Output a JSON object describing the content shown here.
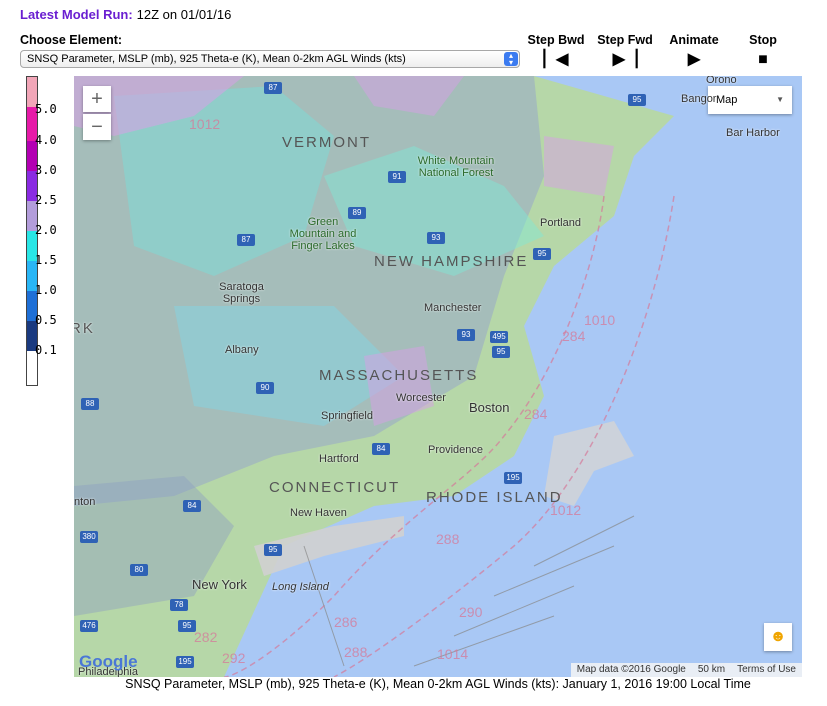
{
  "header": {
    "run_label": "Latest Model Run:",
    "run_value": "12Z on 01/01/16",
    "choose_label": "Choose Element:",
    "selected_element": "SNSQ Parameter, MSLP (mb), 925 Theta-e (K), Mean 0-2km AGL Winds (kts)"
  },
  "controls": [
    {
      "label": "Step Bwd",
      "icon": "step-backward-icon"
    },
    {
      "label": "Step Fwd",
      "icon": "step-forward-icon"
    },
    {
      "label": "Animate",
      "icon": "play-icon"
    },
    {
      "label": "Stop",
      "icon": "stop-icon"
    }
  ],
  "colorscale": {
    "labels": [
      "5.0",
      "4.0",
      "3.0",
      "2.5",
      "2.0",
      "1.5",
      "1.0",
      "0.5",
      "0.1"
    ],
    "colors": [
      "#f2a6b8",
      "#e61aa8",
      "#b300b3",
      "#8a2be2",
      "#b39ddb",
      "#29e6e6",
      "#29b6f6",
      "#1e6fd6",
      "#1a3a80",
      "#ffffff"
    ]
  },
  "map": {
    "zoom_in": "+",
    "zoom_out": "−",
    "map_type": "Map",
    "states": [
      "VERMONT",
      "NEW HAMPSHIRE",
      "MASSACHUSETTS",
      "CONNECTICUT",
      "RHODE ISLAND"
    ],
    "places": [
      "Orono",
      "Bangor",
      "Bar Harbor",
      "White Mountain National Forest",
      "Portland",
      "Green Mountain and Finger Lakes",
      "Saratoga Springs",
      "Manchester",
      "Albany",
      "Worcester",
      "Boston",
      "Springfield",
      "Hartford",
      "Providence",
      "New Haven",
      "New York",
      "Long Island",
      "Philadelphia",
      "RK",
      "nton"
    ],
    "isobars": [
      "1010",
      "284",
      "284",
      "288",
      "290",
      "286",
      "288",
      "1014",
      "1012",
      "292",
      "282",
      "1012"
    ],
    "highways": [
      "87",
      "95",
      "91",
      "89",
      "87",
      "93",
      "95",
      "93",
      "495",
      "95",
      "90",
      "88",
      "84",
      "195",
      "84",
      "95",
      "380",
      "80",
      "78",
      "476",
      "95",
      "195"
    ],
    "footer": {
      "data": "Map data ©2016 Google",
      "scale": "50 km",
      "terms": "Terms of Use"
    },
    "logo": "Google"
  },
  "caption": "SNSQ Parameter, MSLP (mb), 925 Theta-e (K), Mean 0-2km AGL Winds (kts):  January 1, 2016 19:00 Local Time"
}
